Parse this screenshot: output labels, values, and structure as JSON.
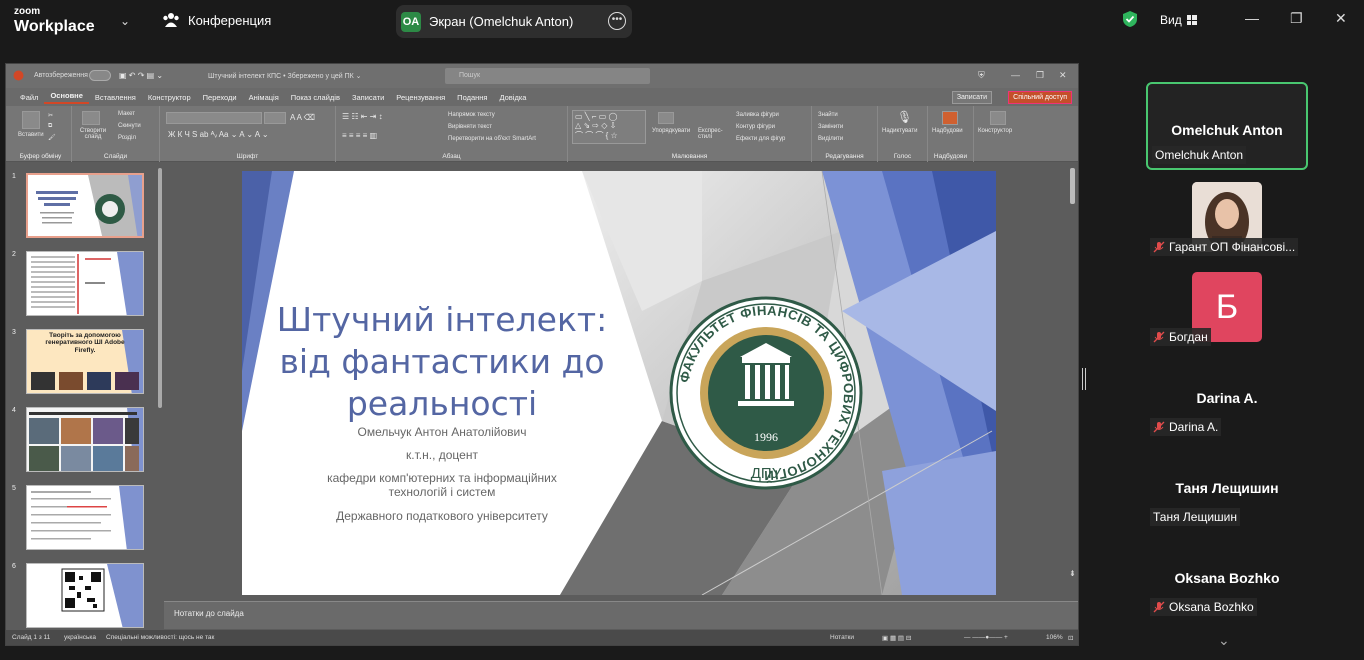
{
  "zoom": {
    "logo_line1": "zoom",
    "logo_line2": "Workplace",
    "meeting_label": "Конференция",
    "share_initials": "OA",
    "share_label": "Экран (Omelchuk Anton)",
    "view_label": "Вид",
    "accent_green": "#2d8a46"
  },
  "ppt": {
    "autosave_label": "Автозбереження",
    "file_title": "Штучний інтелект КПС • Збережено у цей ПК ⌄",
    "search_placeholder": "Пошук",
    "menu": [
      "Файл",
      "Основне",
      "Вставлення",
      "Конструктор",
      "Переходи",
      "Анімація",
      "Показ слайдів",
      "Записати",
      "Рецензування",
      "Подання",
      "Довідка"
    ],
    "record_button": "Записати",
    "share_button": "Спільний доступ",
    "ribbon_groups": [
      "Буфер обміну",
      "Слайди",
      "Шрифт",
      "Абзац",
      "Малювання",
      "Редагування",
      "Голос",
      "Надбудови"
    ],
    "ribbon": {
      "paste": "Вставити",
      "new_slide": "Створити слайд",
      "layout": "Макет",
      "reset": "Скинути",
      "section": "Розділ",
      "text_direction": "Напрямок тексту",
      "align_text": "Вирівняти текст",
      "smartart": "Перетворити на об'єкт SmartArt",
      "arrange": "Упорядкувати",
      "quick_styles": "Експрес-стилі",
      "shape_fill": "Заливка фігури",
      "shape_outline": "Контур фігури",
      "shape_effects": "Ефекти для фігур",
      "find": "Знайти",
      "replace": "Замінити",
      "select": "Виділити",
      "dictate": "Надиктувати",
      "addins": "Надбудови",
      "designer": "Конструктор"
    },
    "slide_numbers": [
      "1",
      "2",
      "3",
      "4",
      "5",
      "6"
    ],
    "thumb3_text": "Творіть за допомогою генеративного ШІ Adobe Firefly.",
    "slide": {
      "title": "Штучний інтелект: від фантастики до реальності",
      "author": "Омельчук Антон Анатолійович",
      "degree": "к.т.н., доцент",
      "dept": "кафедри комп'ютерних та інформаційних технологій і систем",
      "university": "Державного податкового університету",
      "emblem_ring_text": "ФАКУЛЬТЕТ ФІНАНСІВ ТА ЦИФРОВИХ ТЕХНОЛОГІЙ",
      "emblem_year": "1996",
      "emblem_abbr": "ДПУ"
    },
    "notes_placeholder": "Нотатки до слайда",
    "status": {
      "slide_of": "Слайд 1 з 11",
      "language": "українська",
      "accessibility": "Спеціальні можливості: щось не так",
      "notes_btn": "Нотатки",
      "zoom": "106%"
    }
  },
  "participants": [
    {
      "display": "Omelchuk Anton",
      "label": "Omelchuk Anton",
      "muted": false,
      "type": "name",
      "active": true
    },
    {
      "display": "",
      "label": "Гарант ОП Фінансові...",
      "muted": true,
      "type": "photo",
      "active": false
    },
    {
      "display": "Б",
      "label": "Богдан",
      "muted": true,
      "type": "avatar",
      "active": false
    },
    {
      "display": "Darina A.",
      "label": "Darina A.",
      "muted": true,
      "type": "name",
      "active": false
    },
    {
      "display": "Таня Лещишин",
      "label": "Таня Лещишин",
      "muted": false,
      "type": "name",
      "active": false
    },
    {
      "display": "Oksana Bozhko",
      "label": "Oksana Bozhko",
      "muted": true,
      "type": "name",
      "active": false
    }
  ]
}
